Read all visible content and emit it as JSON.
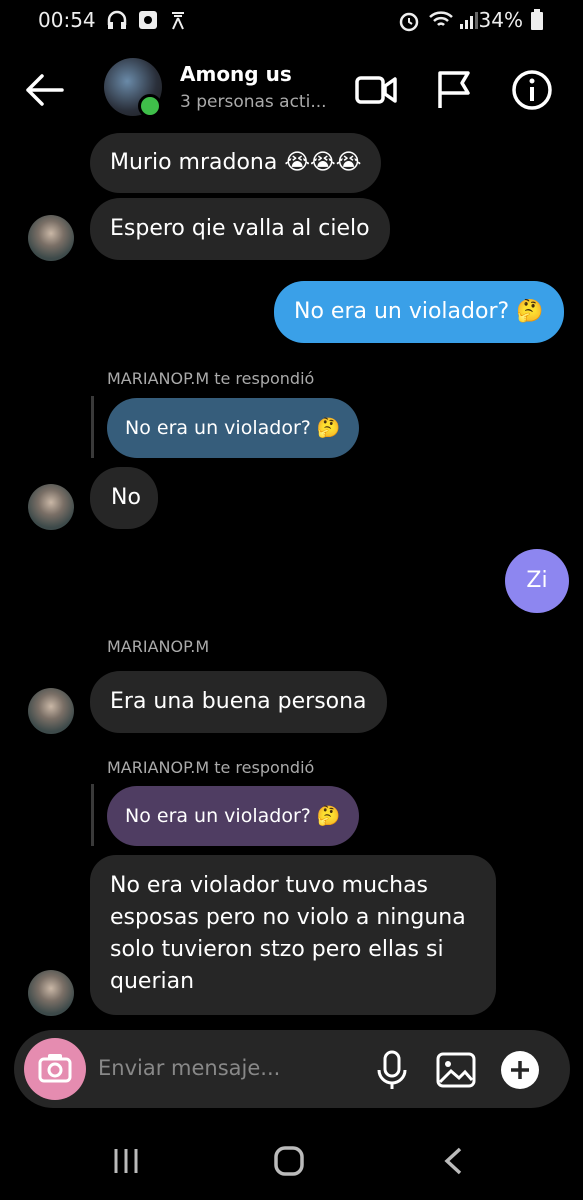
{
  "status": {
    "time": "00:54",
    "battery": "34%"
  },
  "header": {
    "title": "Among us",
    "subtitle": "3 personas acti..."
  },
  "messages": {
    "m1": "Murio mradona 😭😭😭",
    "m2": "Espero qie valla al cielo",
    "m3": "No era un violador? 🤔",
    "reply1_caption": "MARIANOP.M te respondió",
    "reply1_quote": "No era un violador? 🤔",
    "m4": "No",
    "m5": "Zi",
    "sender2": "MARIANOP.M",
    "m6": "Era una buena persona",
    "reply2_caption": "MARIANOP.M te respondió",
    "reply2_quote": "No era un violador? 🤔",
    "m7": "No era violador tuvo muchas esposas pero no violo a ninguna solo tuvieron stzo pero ellas si querian"
  },
  "composer": {
    "placeholder": "Enviar mensaje..."
  },
  "colors": {
    "sent": "#3aa0e8",
    "sent2": "#8d86f0",
    "received": "#262626",
    "online": "#3fbf4a"
  }
}
